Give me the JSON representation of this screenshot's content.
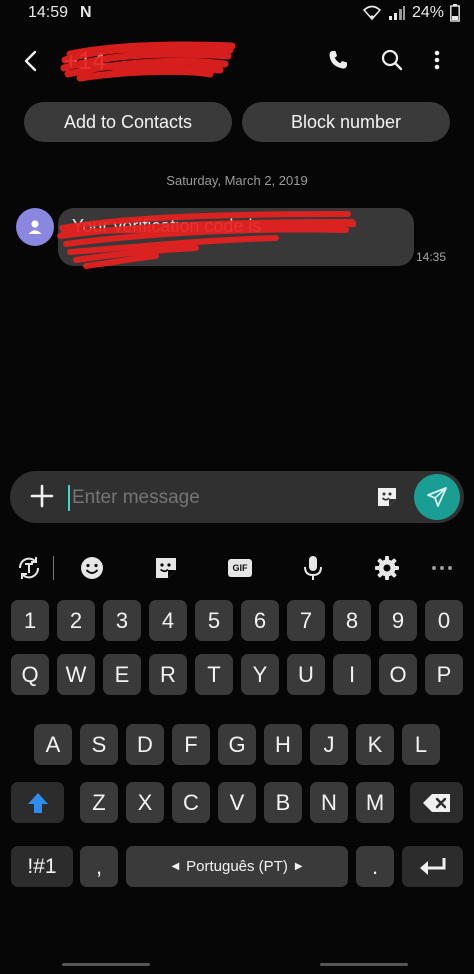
{
  "status": {
    "time": "14:59",
    "notif_icon": "N",
    "battery": "24%"
  },
  "header": {
    "title": "+14",
    "call_icon": "phone-icon",
    "search_icon": "search-icon",
    "more_icon": "more-vertical-icon"
  },
  "actions": {
    "add_contacts": "Add to Contacts",
    "block_number": "Block number"
  },
  "conversation": {
    "date": "Saturday, March 2, 2019",
    "messages": [
      {
        "text": "Your verification code is",
        "text2": "",
        "time": "14:35"
      }
    ]
  },
  "composer": {
    "placeholder": "Enter message"
  },
  "keyboard": {
    "row_numbers": [
      "1",
      "2",
      "3",
      "4",
      "5",
      "6",
      "7",
      "8",
      "9",
      "0"
    ],
    "row_q": [
      "Q",
      "W",
      "E",
      "R",
      "T",
      "Y",
      "U",
      "I",
      "O",
      "P"
    ],
    "row_a": [
      "A",
      "S",
      "D",
      "F",
      "G",
      "H",
      "J",
      "K",
      "L"
    ],
    "row_z": [
      "Z",
      "X",
      "C",
      "V",
      "B",
      "N",
      "M"
    ],
    "symbols": "!#1",
    "comma": ",",
    "space_label": "Português (PT)",
    "period": ".",
    "gif": "GIF"
  },
  "colors": {
    "accent": "#1a9d93",
    "avatar": "#8b86e0",
    "shift": "#2f8cf0",
    "redaction": "#e8211e"
  }
}
